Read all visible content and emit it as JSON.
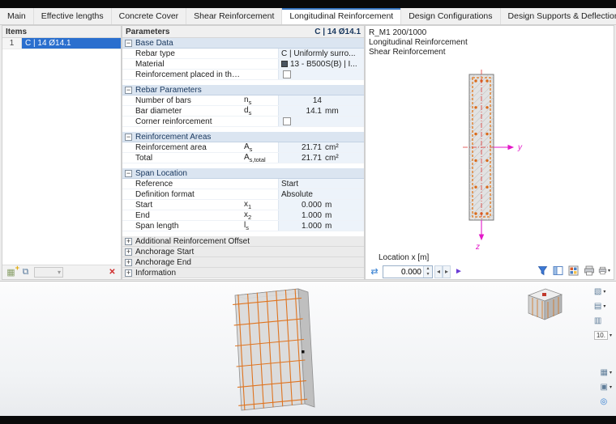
{
  "tabs": [
    {
      "label": "Main",
      "active": false
    },
    {
      "label": "Effective lengths",
      "active": false
    },
    {
      "label": "Concrete Cover",
      "active": false
    },
    {
      "label": "Shear Reinforcement",
      "active": false
    },
    {
      "label": "Longitudinal Reinforcement",
      "active": true
    },
    {
      "label": "Design Configurations",
      "active": false
    },
    {
      "label": "Design Supports & Deflection",
      "active": false
    }
  ],
  "items_panel": {
    "title": "Items",
    "rows": [
      {
        "num": "1",
        "label": "C | 14 Ø14.1",
        "selected": true
      }
    ]
  },
  "parameters": {
    "title": "Parameters",
    "selection": "C | 14 Ø14.1",
    "sections": [
      {
        "label": "Base Data",
        "expanded": true,
        "rows": [
          {
            "kind": "wide",
            "label": "Rebar type",
            "value": "C | Uniformly surro..."
          },
          {
            "kind": "wide",
            "label": "Material",
            "value": "13 - B500S(B) | I...",
            "swatch": "#4a5560"
          },
          {
            "kind": "checkbox",
            "label": "Reinforcement placed in the b...",
            "checked": false
          }
        ]
      },
      {
        "label": "Rebar Parameters",
        "expanded": true,
        "rows": [
          {
            "kind": "num",
            "label": "Number of bars",
            "sym": "n",
            "sub": "s",
            "value": "14",
            "unit": ""
          },
          {
            "kind": "num",
            "label": "Bar diameter",
            "sym": "d",
            "sub": "s",
            "value": "14.1",
            "unit": "mm"
          },
          {
            "kind": "checkbox",
            "label": "Corner reinforcement",
            "checked": false
          }
        ]
      },
      {
        "label": "Reinforcement Areas",
        "expanded": true,
        "rows": [
          {
            "kind": "num",
            "label": "Reinforcement area",
            "sym": "A",
            "sub": "s",
            "value": "21.71",
            "unit": "cm²"
          },
          {
            "kind": "num",
            "label": "Total",
            "sym": "A",
            "sub": "s,total",
            "value": "21.71",
            "unit": "cm²"
          }
        ]
      },
      {
        "label": "Span Location",
        "expanded": true,
        "rows": [
          {
            "kind": "select",
            "label": "Reference",
            "value": "Start"
          },
          {
            "kind": "select",
            "label": "Definition format",
            "value": "Absolute"
          },
          {
            "kind": "num",
            "label": "Start",
            "sym": "x",
            "sub": "1",
            "value": "0.000",
            "unit": "m"
          },
          {
            "kind": "num",
            "label": "End",
            "sym": "x",
            "sub": "2",
            "value": "1.000",
            "unit": "m"
          },
          {
            "kind": "num",
            "label": "Span length",
            "sym": "l",
            "sub": "s",
            "value": "1.000",
            "unit": "m"
          }
        ]
      },
      {
        "label": "Additional Reinforcement Offset",
        "expanded": false,
        "rows": []
      },
      {
        "label": "Anchorage Start",
        "expanded": false,
        "rows": []
      },
      {
        "label": "Anchorage End",
        "expanded": false,
        "rows": []
      },
      {
        "label": "Information",
        "expanded": false,
        "rows": []
      }
    ]
  },
  "detail": {
    "info_lines": [
      "R_M1 200/1000",
      "Longitudinal Reinforcement",
      "Shear Reinforcement"
    ],
    "axis_y": "y",
    "axis_z": "z",
    "location_label": "Location x [m]",
    "location_value": "0.000"
  },
  "viewport": {
    "toolbar_top": [
      {
        "name": "view-direction-button",
        "icon": "view-cube-icon",
        "glyph": "▧",
        "chevron": true
      },
      {
        "name": "display-mode-button",
        "icon": "render-mode-icon",
        "glyph": "▤",
        "chevron": true
      },
      {
        "name": "section-view-button",
        "icon": "section-plane-icon",
        "glyph": "▥",
        "chevron": false
      },
      {
        "name": "scale-factor-button",
        "icon": "scale-icon",
        "glyph": "10.",
        "chevron": true,
        "boxed": true
      }
    ],
    "toolbar_bottom": [
      {
        "name": "visibility-options-button",
        "icon": "grid-icon",
        "glyph": "▦",
        "chevron": true
      },
      {
        "name": "print-graphic-button",
        "icon": "printer-icon",
        "glyph": "▣",
        "chevron": true
      },
      {
        "name": "reset-view-button",
        "icon": "target-icon",
        "glyph": "◎",
        "chevron": false
      }
    ]
  },
  "icons": {
    "new_item_grid": "▦",
    "new_item_plus": "+",
    "copy_item": "⧉",
    "combo_caret": "▾",
    "delete_item": "✕",
    "location_sync": "⇄",
    "spin_up": "▴",
    "spin_down": "▾",
    "step_left": "◂",
    "step_right": "▸",
    "location_pointer": "►",
    "collapse": "−",
    "expand": "+"
  },
  "colors": {
    "selection_blue": "#2a6fce",
    "rebar_orange": "#e2761b",
    "axis_magenta": "#e318c8",
    "centerline_red": "#dd3333"
  }
}
